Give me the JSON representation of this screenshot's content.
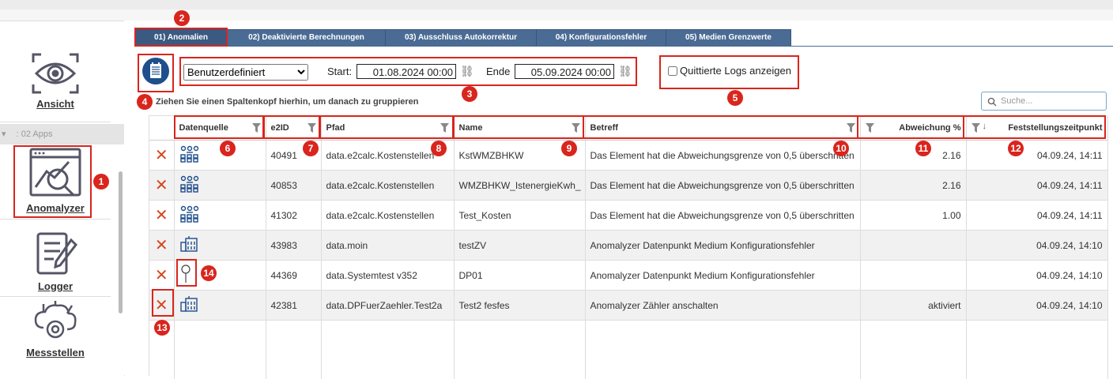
{
  "sidebar": {
    "items": [
      {
        "label": "Ansicht",
        "icon": "eye-icon"
      },
      {
        "label": "Anomalyzer",
        "icon": "anomaly-chart-icon"
      },
      {
        "label": "Logger",
        "icon": "logger-icon"
      },
      {
        "label": "Messstellen",
        "icon": "measuring-points-icon"
      }
    ],
    "group_label": ": 02 Apps"
  },
  "tabs": [
    {
      "label": "01) Anomalien",
      "active": true
    },
    {
      "label": "02) Deaktivierte Berechnungen",
      "active": false
    },
    {
      "label": "03) Ausschluss Autokorrektur",
      "active": false
    },
    {
      "label": "04) Konfigurationsfehler",
      "active": false
    },
    {
      "label": "05) Medien Grenzwerte",
      "active": false
    }
  ],
  "filter": {
    "period_value": "Benutzerdefiniert",
    "start_label": "Start:",
    "start_value": "01.08.2024 00:00",
    "end_label": "Ende",
    "end_value": "05.09.2024 00:00",
    "checkbox_label": "Quittierte Logs anzeigen"
  },
  "group_hint": "Ziehen Sie einen Spaltenkopf hierhin, um danach zu gruppieren",
  "search": {
    "placeholder": "Suche..."
  },
  "columns": [
    "Datenquelle",
    "e2ID",
    "Pfad",
    "Name",
    "Betreff",
    "Abweichung %",
    "Feststellungszeitpunkt"
  ],
  "rows": [
    {
      "icon": "network-icon",
      "e2id": "40491",
      "pfad": "data.e2calc.Kostenstellen",
      "name": "KstWMZBHKW",
      "betreff": "Das Element hat die Abweichungsgrenze von 0,5 überschritten",
      "abweichung": "2.16",
      "zeit": "04.09.24, 14:11"
    },
    {
      "icon": "network-icon",
      "e2id": "40853",
      "pfad": "data.e2calc.Kostenstellen",
      "name": "WMZBHKW_IstenergieKwh_",
      "betreff": "Das Element hat die Abweichungsgrenze von 0,5 überschritten",
      "abweichung": "2.16",
      "zeit": "04.09.24, 14:11"
    },
    {
      "icon": "network-icon",
      "e2id": "41302",
      "pfad": "data.e2calc.Kostenstellen",
      "name": "Test_Kosten",
      "betreff": "Das Element hat die Abweichungsgrenze von 0,5 überschritten",
      "abweichung": "1.00",
      "zeit": "04.09.24, 14:11"
    },
    {
      "icon": "meter-icon",
      "e2id": "43983",
      "pfad": "data.moin",
      "name": "testZV",
      "betreff": "Anomalyzer Datenpunkt Medium Konfigurationsfehler",
      "abweichung": "",
      "zeit": "04.09.24, 14:10"
    },
    {
      "icon": "pin-icon",
      "e2id": "44369",
      "pfad": "data.Systemtest v352",
      "name": "DP01",
      "betreff": "Anomalyzer Datenpunkt Medium Konfigurationsfehler",
      "abweichung": "",
      "zeit": "04.09.24, 14:10"
    },
    {
      "icon": "meter-icon",
      "e2id": "42381",
      "pfad": "data.DPFuerZaehler.Test2a",
      "name": "Test2 fesfes",
      "betreff": "Anomalyzer Zähler anschalten",
      "abweichung": "aktiviert",
      "zeit": "04.09.24, 14:10"
    }
  ],
  "annotations": [
    "1",
    "2",
    "3",
    "4",
    "5",
    "6",
    "7",
    "8",
    "9",
    "10",
    "11",
    "12",
    "13",
    "14"
  ],
  "colors": {
    "accent": "#4a6b94",
    "annotation": "#d9251d",
    "delete": "#d9451f"
  }
}
